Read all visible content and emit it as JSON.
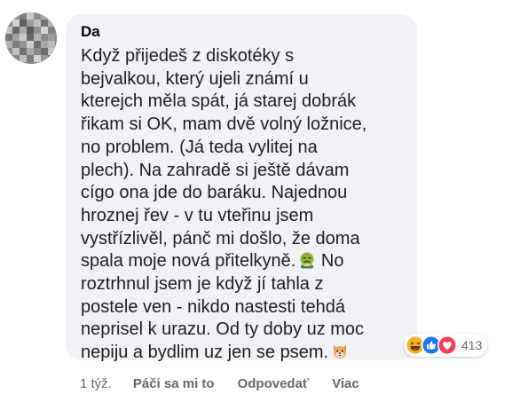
{
  "comment": {
    "author": "Da",
    "lines": [
      "Když přijedeš z diskotéky s",
      "bejvalkou, který ujeli známí u",
      "kterejch měla spát, já starej dobrák",
      "řikam si OK, mam dvě volný ložnice,",
      "no problem. (Já teda vylitej na",
      "plech). Na zahradě si ještě dávam",
      "cígo ona jde do baráku. Najednou",
      "hroznej řev - v tu vteřinu jsem",
      "vystřízlivěl, pánč mi došlo, že doma",
      "spala moje nová přitelkyně.",
      "roztrhnul jsem je když jí tahla z",
      "postele ven - nikdo nastesti tehdá",
      "neprisel k urazu. Od ty doby uz moc",
      "nepiju a bydlim uz jen se psem."
    ],
    "line10_tail": "No",
    "emoji_after_line10": "nauseated-face-icon",
    "emoji_after_line14": "dog-face-icon"
  },
  "reactions": {
    "icons": [
      "haha-icon",
      "like-icon",
      "love-icon"
    ],
    "count": "413",
    "colors": {
      "haha": "#f7b125",
      "like": "#1877f2",
      "love": "#f33e58"
    }
  },
  "actions": {
    "time": "1 týž.",
    "like_label": "Páči sa mi to",
    "reply_label": "Odpovedať",
    "more_label": "Viac"
  },
  "colors": {
    "bubble": "#f0f2f5",
    "text": "#1c1e21",
    "meta": "#65676b"
  }
}
